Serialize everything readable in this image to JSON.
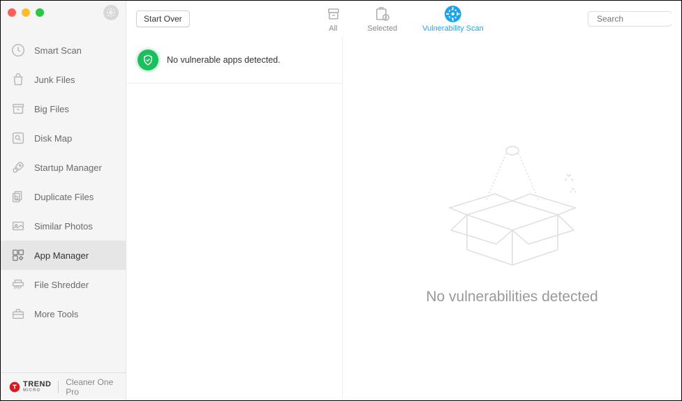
{
  "sidebar": {
    "items": [
      {
        "label": "Smart Scan",
        "icon": "clock"
      },
      {
        "label": "Junk Files",
        "icon": "bag"
      },
      {
        "label": "Big Files",
        "icon": "archive"
      },
      {
        "label": "Disk Map",
        "icon": "search-disk"
      },
      {
        "label": "Startup Manager",
        "icon": "rocket"
      },
      {
        "label": "Duplicate Files",
        "icon": "duplicate"
      },
      {
        "label": "Similar Photos",
        "icon": "photos"
      },
      {
        "label": "App Manager",
        "icon": "apps"
      },
      {
        "label": "File Shredder",
        "icon": "shredder"
      },
      {
        "label": "More Tools",
        "icon": "toolbox"
      }
    ],
    "active_index": 7
  },
  "toolbar": {
    "start_over_label": "Start Over",
    "tabs": [
      {
        "label": "All",
        "icon": "box"
      },
      {
        "label": "Selected",
        "icon": "box-check"
      },
      {
        "label": "Vulnerability Scan",
        "icon": "scan"
      }
    ],
    "active_tab_index": 2
  },
  "search": {
    "placeholder": "Search"
  },
  "status": {
    "message": "No vulnerable apps detected."
  },
  "empty_state": {
    "title": "No vulnerabilities detected"
  },
  "footer": {
    "brand": "TREND",
    "brand_sub": "MICRO",
    "product": "Cleaner One Pro"
  },
  "colors": {
    "accent": "#1ea5e9",
    "success": "#1bbf5c",
    "sidebar_bg": "#f5f5f5"
  }
}
